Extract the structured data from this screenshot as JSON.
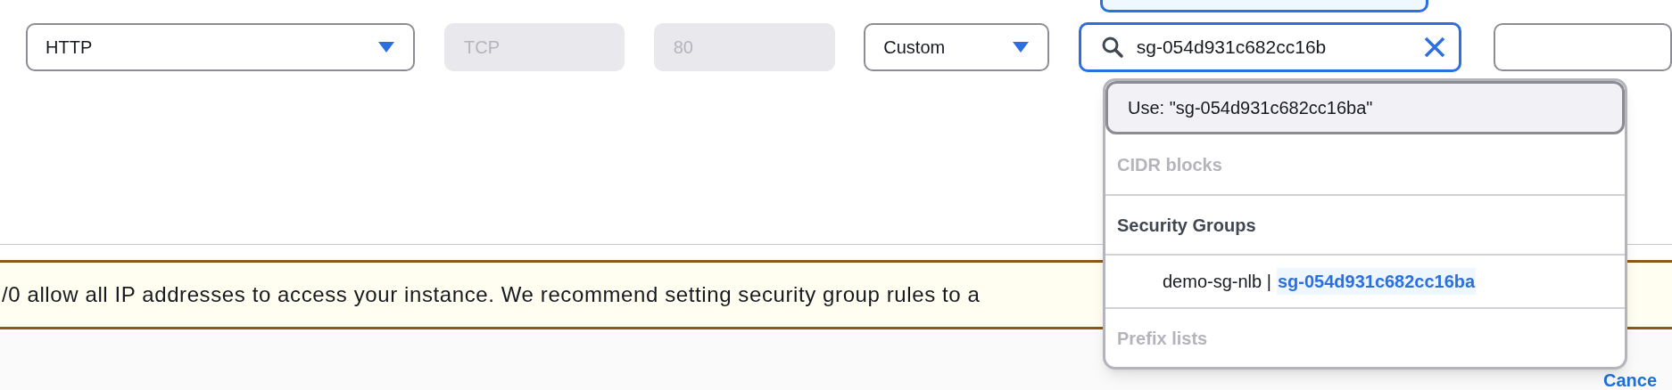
{
  "rule_row": {
    "type_select": {
      "value": "HTTP"
    },
    "protocol": {
      "value": "TCP",
      "disabled": true
    },
    "port_range": {
      "value": "80",
      "disabled": true
    },
    "source_select": {
      "value": "Custom"
    },
    "source_search": {
      "value": "sg-054d931c682cc16b"
    }
  },
  "dropdown": {
    "items": [
      {
        "kind": "use",
        "label": "Use: \"sg-054d931c682cc16ba\"",
        "highlighted": true
      },
      {
        "kind": "group",
        "label": "CIDR blocks",
        "disabled": true
      },
      {
        "kind": "group",
        "label": "Security Groups",
        "disabled": false
      },
      {
        "kind": "option",
        "name": "demo-sg-nlb |",
        "id": "sg-054d931c682cc16ba",
        "highlighted": false
      },
      {
        "kind": "group",
        "label": "Prefix lists",
        "disabled": true
      }
    ]
  },
  "warning": {
    "text": "/0 allow all IP addresses to access your instance. We recommend setting security group rules to a"
  },
  "footer": {
    "cancel_link": "Cance"
  }
}
